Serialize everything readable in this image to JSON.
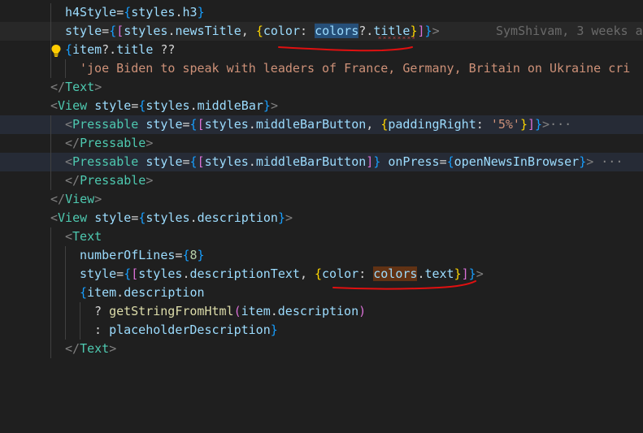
{
  "blame": "SymShivam, 3 weeks a",
  "lines": {
    "l1": {
      "a": "h4Style",
      "b": "=",
      "c": "{",
      "d": "styles",
      "e": ".",
      "f": "h3",
      "g": "}"
    },
    "l2": {
      "a": "style",
      "b": "=",
      "c": "{",
      "d": "[",
      "e": "styles",
      "f": ".",
      "g": "newsTitle",
      "h": ", ",
      "i": "{",
      "j": "color",
      "k": ": ",
      "l": "colors",
      "m": "?.",
      "n": "title",
      "o": "}",
      "p": "]",
      "q": "}",
      "r": ">"
    },
    "l3": {
      "a": "{",
      "b": "item",
      "c": "?.",
      "d": "title",
      "e": " ??"
    },
    "l4": {
      "a": "'joe Biden to speak with leaders of France, Germany, Britain on Ukraine cri"
    },
    "l5": {
      "a": "</",
      "b": "Text",
      "c": ">"
    },
    "l6": {
      "a": "<",
      "b": "View",
      "c": " ",
      "d": "style",
      "e": "=",
      "f": "{",
      "g": "styles",
      "h": ".",
      "i": "middleBar",
      "j": "}",
      "k": ">"
    },
    "l7": {
      "a": "<",
      "b": "Pressable",
      "c": " ",
      "d": "style",
      "e": "=",
      "f": "{",
      "g": "[",
      "h": "styles",
      "i": ".",
      "j": "middleBarButton",
      "k": ", ",
      "l": "{",
      "m": "paddingRight",
      "n": ": ",
      "o": "'5%'",
      "p": "}",
      "q": "]",
      "r": "}",
      "s": ">",
      "t": "···"
    },
    "l8": {
      "a": "</",
      "b": "Pressable",
      "c": ">"
    },
    "l9": {
      "a": "<",
      "b": "Pressable",
      "c": " ",
      "d": "style",
      "e": "=",
      "f": "{",
      "g": "[",
      "h": "styles",
      "i": ".",
      "j": "middleBarButton",
      "k": "]",
      "l": "}",
      "m": " ",
      "n": "onPress",
      "o": "=",
      "p": "{",
      "q": "openNewsInBrowser",
      "r": "}",
      "s": ">",
      "t": " ···"
    },
    "l10": {
      "a": "</",
      "b": "Pressable",
      "c": ">"
    },
    "l11": {
      "a": "</",
      "b": "View",
      "c": ">"
    },
    "l12": {
      "a": "<",
      "b": "View",
      "c": " ",
      "d": "style",
      "e": "=",
      "f": "{",
      "g": "styles",
      "h": ".",
      "i": "description",
      "j": "}",
      "k": ">"
    },
    "l13": {
      "a": "<",
      "b": "Text"
    },
    "l14": {
      "a": "numberOfLines",
      "b": "=",
      "c": "{",
      "d": "8",
      "e": "}"
    },
    "l15": {
      "a": "style",
      "b": "=",
      "c": "{",
      "d": "[",
      "e": "styles",
      "f": ".",
      "g": "descriptionText",
      "h": ", ",
      "i": "{",
      "j": "color",
      "k": ": ",
      "l": "colors",
      "m": ".",
      "n": "text",
      "o": "}",
      "p": "]",
      "q": "}",
      "r": ">"
    },
    "l16": {
      "a": "{",
      "b": "item",
      "c": ".",
      "d": "description"
    },
    "l17": {
      "a": "? ",
      "b": "getStringFromHtml",
      "c": "(",
      "d": "item",
      "e": ".",
      "f": "description",
      "g": ")"
    },
    "l18": {
      "a": ": ",
      "b": "placeholderDescription",
      "c": "}"
    },
    "l19": {
      "a": "</",
      "b": "Text",
      "c": ">"
    }
  },
  "colors": {
    "background": "#1f1f1f",
    "annotation_ink": "#e01010",
    "selection_blue": "#264f78",
    "selection_brown": "#613214"
  }
}
